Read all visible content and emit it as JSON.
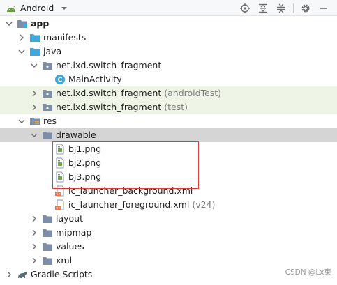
{
  "toolbar": {
    "view_label": "Android",
    "icons": [
      "android-icon",
      "dropdown-arrow-icon",
      "locate-icon",
      "expand-all-icon",
      "collapse-all-icon",
      "gear-icon",
      "minimize-icon"
    ]
  },
  "tree": {
    "app": "app",
    "manifests": "manifests",
    "java": "java",
    "pkg_main": "net.lxd.switch_fragment",
    "main_activity": "MainActivity",
    "pkg_android_test": "net.lxd.switch_fragment",
    "pkg_android_test_hint": "(androidTest)",
    "pkg_test": "net.lxd.switch_fragment",
    "pkg_test_hint": "(test)",
    "res": "res",
    "drawable": "drawable",
    "bj1": "bj1.png",
    "bj2": "bj2.png",
    "bj3": "bj3.png",
    "ic_bg": "ic_launcher_background.xml",
    "ic_fg": "ic_launcher_foreground.xml",
    "ic_fg_hint": "(v24)",
    "layout": "layout",
    "mipmap": "mipmap",
    "values": "values",
    "xml": "xml",
    "gradle": "Gradle Scripts"
  },
  "watermark": "CSDN @Lx束",
  "colors": {
    "folder": "#7f8ea8",
    "source_folder": "#3fa7d9",
    "highlight_row": "#eef5e7",
    "selected_row": "#d5d5d5",
    "annotation_box": "#e23b3b"
  }
}
